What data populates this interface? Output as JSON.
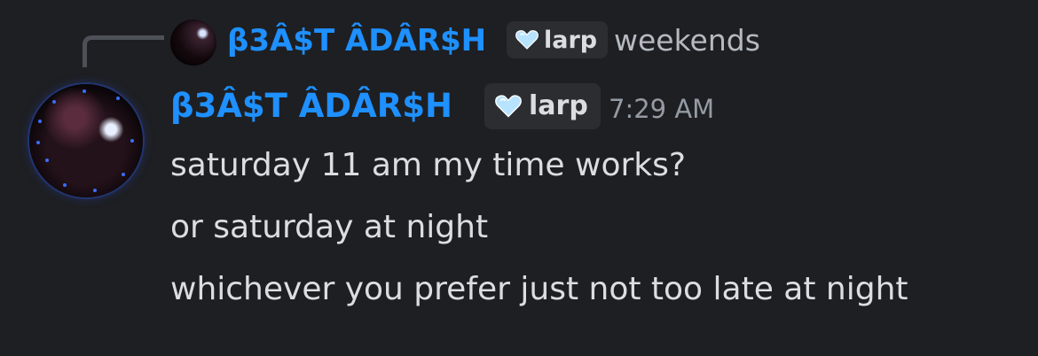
{
  "reply": {
    "author": "β3Â$T ÂDÂR$H",
    "tag": "larp",
    "text": "weekends"
  },
  "message": {
    "author": "β3Â$T ÂDÂR$H",
    "tag": "larp",
    "timestamp": "7:29 AM",
    "lines": [
      "saturday 11 am my time works?",
      "or saturday at night",
      "whichever you prefer just not too late at night"
    ]
  },
  "colors": {
    "background": "#1e1f22",
    "author_name": "#1e90ff",
    "message_text": "#dbdee1",
    "muted_text": "#949ba4",
    "tag_background": "#2b2d31",
    "heart_badge": "#b7e3ff"
  },
  "icons": {
    "tag_badge": "heart-icon"
  }
}
